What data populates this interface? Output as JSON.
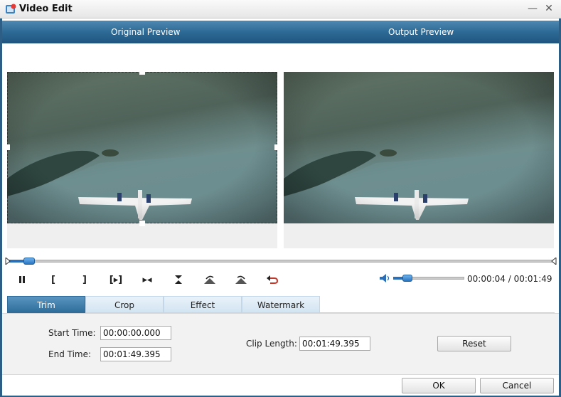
{
  "window": {
    "title": "Video Edit",
    "minimize_glyph": "—",
    "close_glyph": "✕"
  },
  "preview": {
    "original_label": "Original Preview",
    "output_label": "Output Preview"
  },
  "playback": {
    "progress_fraction": 0.04,
    "volume_fraction": 0.2,
    "current_time": "00:00:04",
    "separator": "/",
    "total_time": "00:01:49",
    "buttons": {
      "pause": "pause-icon",
      "mark_in": "[",
      "mark_out": "]",
      "play_selection": "[▸]",
      "next_frame": "▸◂",
      "trim_marks": "trim-icon",
      "rotate_left": "rotate-left-icon",
      "rotate_right": "rotate-right-icon",
      "undo": "undo-icon"
    }
  },
  "tabs": [
    {
      "label": "Trim",
      "active": true
    },
    {
      "label": "Crop",
      "active": false
    },
    {
      "label": "Effect",
      "active": false
    },
    {
      "label": "Watermark",
      "active": false
    }
  ],
  "trim": {
    "start_label": "Start Time:",
    "start_value": "00:00:00.000",
    "end_label": "End Time:",
    "end_value": "00:01:49.395",
    "clip_length_label": "Clip Length:",
    "clip_length_value": "00:01:49.395",
    "reset_label": "Reset"
  },
  "footer": {
    "ok_label": "OK",
    "cancel_label": "Cancel"
  },
  "colors": {
    "accent": "#2d6a95",
    "slider": "#2b6fb8"
  }
}
